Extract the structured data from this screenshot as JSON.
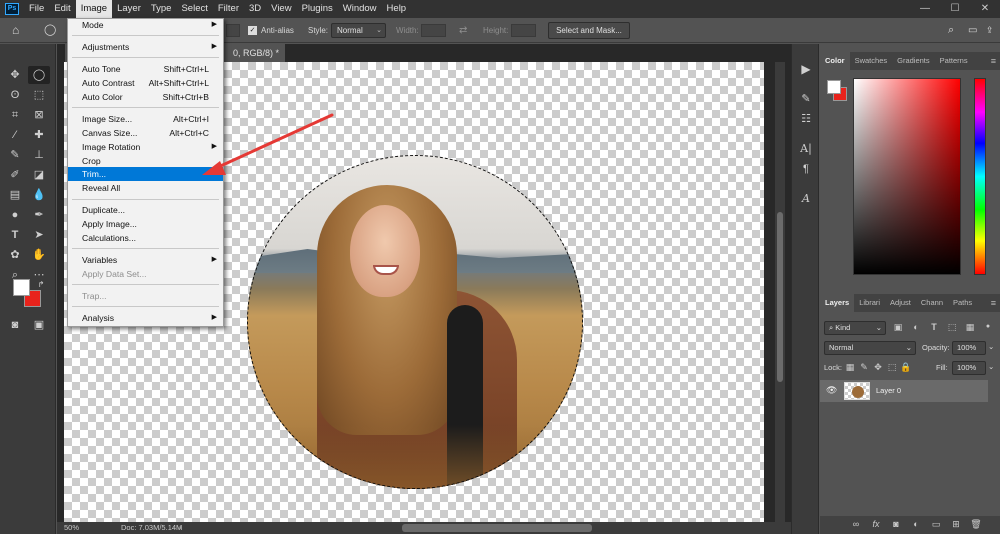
{
  "app": {
    "icon_label": "Ps"
  },
  "menubar": {
    "items": [
      "File",
      "Edit",
      "Image",
      "Layer",
      "Type",
      "Select",
      "Filter",
      "3D",
      "View",
      "Plugins",
      "Window",
      "Help"
    ],
    "active": "Image"
  },
  "window_controls": {
    "minimize": "—",
    "maximize": "☐",
    "close": "✕"
  },
  "options": {
    "anti_alias_label": "Anti-alias",
    "style_label": "Style:",
    "style_value": "Normal",
    "width_label": "Width:",
    "height_label": "Height:",
    "select_mask_label": "Select and Mask...",
    "swap_glyph": "⇄"
  },
  "document": {
    "tab_title": "0, RGB/8) *",
    "zoom": "50%",
    "doc_info": "Doc: 7.03M/5.14M"
  },
  "image_menu": {
    "items": [
      {
        "label": "Mode",
        "shortcut": "",
        "submenu": true,
        "state": "normal"
      },
      {
        "label": "Adjustments",
        "shortcut": "",
        "submenu": true,
        "state": "normal"
      },
      {
        "label": "Auto Tone",
        "shortcut": "Shift+Ctrl+L",
        "submenu": false,
        "state": "normal"
      },
      {
        "label": "Auto Contrast",
        "shortcut": "Alt+Shift+Ctrl+L",
        "submenu": false,
        "state": "normal"
      },
      {
        "label": "Auto Color",
        "shortcut": "Shift+Ctrl+B",
        "submenu": false,
        "state": "normal"
      },
      {
        "label": "Image Size...",
        "shortcut": "Alt+Ctrl+I",
        "submenu": false,
        "state": "normal"
      },
      {
        "label": "Canvas Size...",
        "shortcut": "Alt+Ctrl+C",
        "submenu": false,
        "state": "normal"
      },
      {
        "label": "Image Rotation",
        "shortcut": "",
        "submenu": true,
        "state": "normal"
      },
      {
        "label": "Crop",
        "shortcut": "",
        "submenu": false,
        "state": "normal"
      },
      {
        "label": "Trim...",
        "shortcut": "",
        "submenu": false,
        "state": "highlighted"
      },
      {
        "label": "Reveal All",
        "shortcut": "",
        "submenu": false,
        "state": "normal"
      },
      {
        "label": "Duplicate...",
        "shortcut": "",
        "submenu": false,
        "state": "normal"
      },
      {
        "label": "Apply Image...",
        "shortcut": "",
        "submenu": false,
        "state": "normal"
      },
      {
        "label": "Calculations...",
        "shortcut": "",
        "submenu": false,
        "state": "normal"
      },
      {
        "label": "Variables",
        "shortcut": "",
        "submenu": true,
        "state": "normal"
      },
      {
        "label": "Apply Data Set...",
        "shortcut": "",
        "submenu": false,
        "state": "disabled"
      },
      {
        "label": "Trap...",
        "shortcut": "",
        "submenu": false,
        "state": "disabled"
      },
      {
        "label": "Analysis",
        "shortcut": "",
        "submenu": true,
        "state": "normal"
      }
    ]
  },
  "color_panel": {
    "tabs": [
      "Color",
      "Swatches",
      "Gradients",
      "Patterns"
    ],
    "active_tab": "Color",
    "foreground": "#ffffff",
    "background": "#e8231c"
  },
  "layers_panel": {
    "tabs": [
      "Layers",
      "Librari",
      "Adjust",
      "Chann",
      "Paths"
    ],
    "active_tab": "Layers",
    "filter_kind": "Kind",
    "blend_mode": "Normal",
    "opacity_label": "Opacity:",
    "opacity_value": "100%",
    "lock_label": "Lock:",
    "fill_label": "Fill:",
    "fill_value": "100%",
    "layers": [
      {
        "name": "Layer 0",
        "visible": true
      }
    ],
    "footer_icons": [
      "link-icon",
      "fx-icon",
      "mask-icon",
      "adjustment-icon",
      "folder-icon",
      "new-layer-icon",
      "trash-icon"
    ]
  },
  "colors": {
    "menu_highlight": "#0078d7",
    "annotation_arrow": "#e53935"
  }
}
